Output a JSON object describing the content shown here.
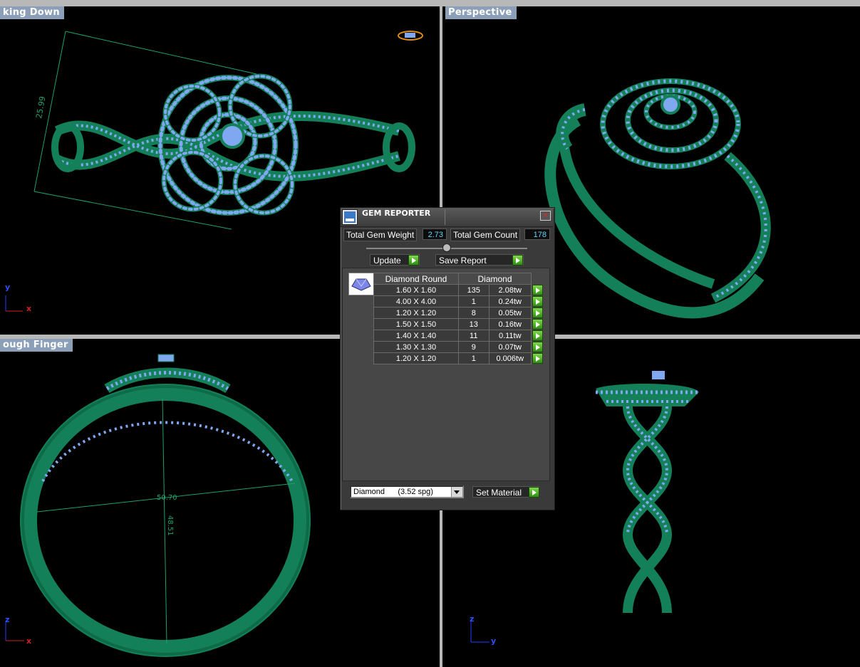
{
  "viewports": {
    "top_left": {
      "title": "king Down",
      "dimension": "25.99",
      "axis_y": "y",
      "axis_x": "x"
    },
    "top_right": {
      "title": "Perspective"
    },
    "bottom_left": {
      "title": "ough Finger",
      "dim_horizontal": "50.70",
      "dim_vertical": "48.51",
      "axis_z": "z",
      "axis_x": "x"
    },
    "bottom_right": {
      "axis_z": "z",
      "axis_y": "y"
    }
  },
  "gem_reporter": {
    "title": "GEM REPORTER",
    "close_glyph": "✕",
    "total_weight_label": "Total Gem Weight",
    "total_weight_value": "2.73",
    "total_count_label": "Total Gem Count",
    "total_count_value": "178",
    "update_label": "Update",
    "save_label": "Save Report",
    "table_headers": [
      "Diamond Round",
      "Diamond"
    ],
    "rows": [
      {
        "size": "1.60 X 1.60",
        "count": "135",
        "weight": "2.08tw"
      },
      {
        "size": "4.00 X 4.00",
        "count": "1",
        "weight": "0.24tw"
      },
      {
        "size": "1.20 X 1.20",
        "count": "8",
        "weight": "0.05tw"
      },
      {
        "size": "1.50 X 1.50",
        "count": "13",
        "weight": "0.16tw"
      },
      {
        "size": "1.40 X 1.40",
        "count": "11",
        "weight": "0.11tw"
      },
      {
        "size": "1.30 X 1.30",
        "count": "9",
        "weight": "0.07tw"
      },
      {
        "size": "1.20 X 1.20",
        "count": "1",
        "weight": "0.006tw"
      }
    ],
    "material_select": "Diamond      (3.52 spg)",
    "set_material_label": "Set Material"
  },
  "colors": {
    "metal": "#14805a",
    "gem": "#7fa8f0",
    "background": "#000000",
    "dimension_line": "#1fa06a",
    "value_text": "#5fd7ff"
  }
}
